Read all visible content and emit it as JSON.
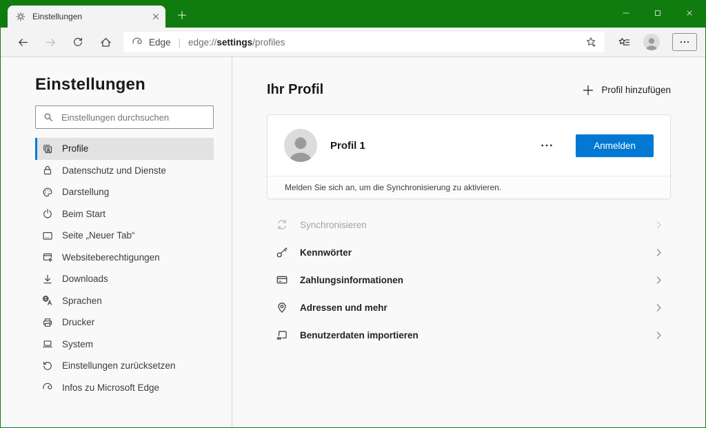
{
  "colors": {
    "frame_green": "#107C10",
    "accent_blue": "#0078D4"
  },
  "window": {
    "tab_title": "Einstellungen"
  },
  "toolbar": {
    "address": {
      "site_name": "Edge",
      "separator": "|",
      "url_prefix": "edge://",
      "url_highlight": "settings",
      "url_suffix": "/profiles"
    }
  },
  "sidebar": {
    "title": "Einstellungen",
    "search_placeholder": "Einstellungen durchsuchen",
    "items": [
      {
        "label": "Profile",
        "icon": "profile-card",
        "selected": true
      },
      {
        "label": "Datenschutz und Dienste",
        "icon": "lock"
      },
      {
        "label": "Darstellung",
        "icon": "palette"
      },
      {
        "label": "Beim Start",
        "icon": "power"
      },
      {
        "label": "Seite „Neuer Tab“",
        "icon": "new-tab-page"
      },
      {
        "label": "Websiteberechtigungen",
        "icon": "site-permissions"
      },
      {
        "label": "Downloads",
        "icon": "download"
      },
      {
        "label": "Sprachen",
        "icon": "languages"
      },
      {
        "label": "Drucker",
        "icon": "printer"
      },
      {
        "label": "System",
        "icon": "laptop"
      },
      {
        "label": "Einstellungen zurücksetzen",
        "icon": "reset"
      },
      {
        "label": "Infos zu Microsoft Edge",
        "icon": "edge-logo"
      }
    ]
  },
  "main": {
    "title": "Ihr Profil",
    "add_profile_label": "Profil hinzufügen",
    "profile_card": {
      "name": "Profil 1",
      "signin_button": "Anmelden",
      "footer": "Melden Sie sich an, um die Synchronisierung zu aktivieren."
    },
    "rows": [
      {
        "label": "Synchronisieren",
        "icon": "sync",
        "disabled": true
      },
      {
        "label": "Kennwörter",
        "icon": "key",
        "disabled": false
      },
      {
        "label": "Zahlungsinformationen",
        "icon": "credit-card",
        "disabled": false
      },
      {
        "label": "Adressen und mehr",
        "icon": "location-pin",
        "disabled": false
      },
      {
        "label": "Benutzerdaten importieren",
        "icon": "import-data",
        "disabled": false
      }
    ]
  }
}
